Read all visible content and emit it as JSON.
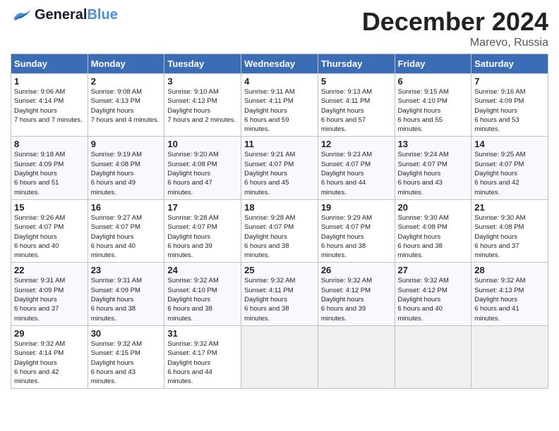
{
  "header": {
    "logo_text_general": "General",
    "logo_text_blue": "Blue",
    "month_title": "December 2024",
    "location": "Marevo, Russia"
  },
  "calendar": {
    "days_of_week": [
      "Sunday",
      "Monday",
      "Tuesday",
      "Wednesday",
      "Thursday",
      "Friday",
      "Saturday"
    ],
    "weeks": [
      [
        {
          "day": "1",
          "sunrise": "9:06 AM",
          "sunset": "4:14 PM",
          "daylight": "7 hours and 7 minutes."
        },
        {
          "day": "2",
          "sunrise": "9:08 AM",
          "sunset": "4:13 PM",
          "daylight": "7 hours and 4 minutes."
        },
        {
          "day": "3",
          "sunrise": "9:10 AM",
          "sunset": "4:12 PM",
          "daylight": "7 hours and 2 minutes."
        },
        {
          "day": "4",
          "sunrise": "9:11 AM",
          "sunset": "4:11 PM",
          "daylight": "6 hours and 59 minutes."
        },
        {
          "day": "5",
          "sunrise": "9:13 AM",
          "sunset": "4:11 PM",
          "daylight": "6 hours and 57 minutes."
        },
        {
          "day": "6",
          "sunrise": "9:15 AM",
          "sunset": "4:10 PM",
          "daylight": "6 hours and 55 minutes."
        },
        {
          "day": "7",
          "sunrise": "9:16 AM",
          "sunset": "4:09 PM",
          "daylight": "6 hours and 53 minutes."
        }
      ],
      [
        {
          "day": "8",
          "sunrise": "9:18 AM",
          "sunset": "4:09 PM",
          "daylight": "6 hours and 51 minutes."
        },
        {
          "day": "9",
          "sunrise": "9:19 AM",
          "sunset": "4:08 PM",
          "daylight": "6 hours and 49 minutes."
        },
        {
          "day": "10",
          "sunrise": "9:20 AM",
          "sunset": "4:08 PM",
          "daylight": "6 hours and 47 minutes."
        },
        {
          "day": "11",
          "sunrise": "9:21 AM",
          "sunset": "4:07 PM",
          "daylight": "6 hours and 45 minutes."
        },
        {
          "day": "12",
          "sunrise": "9:23 AM",
          "sunset": "4:07 PM",
          "daylight": "6 hours and 44 minutes."
        },
        {
          "day": "13",
          "sunrise": "9:24 AM",
          "sunset": "4:07 PM",
          "daylight": "6 hours and 43 minutes."
        },
        {
          "day": "14",
          "sunrise": "9:25 AM",
          "sunset": "4:07 PM",
          "daylight": "6 hours and 42 minutes."
        }
      ],
      [
        {
          "day": "15",
          "sunrise": "9:26 AM",
          "sunset": "4:07 PM",
          "daylight": "6 hours and 40 minutes."
        },
        {
          "day": "16",
          "sunrise": "9:27 AM",
          "sunset": "4:07 PM",
          "daylight": "6 hours and 40 minutes."
        },
        {
          "day": "17",
          "sunrise": "9:28 AM",
          "sunset": "4:07 PM",
          "daylight": "6 hours and 39 minutes."
        },
        {
          "day": "18",
          "sunrise": "9:28 AM",
          "sunset": "4:07 PM",
          "daylight": "6 hours and 38 minutes."
        },
        {
          "day": "19",
          "sunrise": "9:29 AM",
          "sunset": "4:07 PM",
          "daylight": "6 hours and 38 minutes."
        },
        {
          "day": "20",
          "sunrise": "9:30 AM",
          "sunset": "4:08 PM",
          "daylight": "6 hours and 38 minutes."
        },
        {
          "day": "21",
          "sunrise": "9:30 AM",
          "sunset": "4:08 PM",
          "daylight": "6 hours and 37 minutes."
        }
      ],
      [
        {
          "day": "22",
          "sunrise": "9:31 AM",
          "sunset": "4:09 PM",
          "daylight": "6 hours and 37 minutes."
        },
        {
          "day": "23",
          "sunrise": "9:31 AM",
          "sunset": "4:09 PM",
          "daylight": "6 hours and 38 minutes."
        },
        {
          "day": "24",
          "sunrise": "9:32 AM",
          "sunset": "4:10 PM",
          "daylight": "6 hours and 38 minutes."
        },
        {
          "day": "25",
          "sunrise": "9:32 AM",
          "sunset": "4:11 PM",
          "daylight": "6 hours and 38 minutes."
        },
        {
          "day": "26",
          "sunrise": "9:32 AM",
          "sunset": "4:12 PM",
          "daylight": "6 hours and 39 minutes."
        },
        {
          "day": "27",
          "sunrise": "9:32 AM",
          "sunset": "4:12 PM",
          "daylight": "6 hours and 40 minutes."
        },
        {
          "day": "28",
          "sunrise": "9:32 AM",
          "sunset": "4:13 PM",
          "daylight": "6 hours and 41 minutes."
        }
      ],
      [
        {
          "day": "29",
          "sunrise": "9:32 AM",
          "sunset": "4:14 PM",
          "daylight": "6 hours and 42 minutes."
        },
        {
          "day": "30",
          "sunrise": "9:32 AM",
          "sunset": "4:15 PM",
          "daylight": "6 hours and 43 minutes."
        },
        {
          "day": "31",
          "sunrise": "9:32 AM",
          "sunset": "4:17 PM",
          "daylight": "6 hours and 44 minutes."
        },
        null,
        null,
        null,
        null
      ]
    ]
  }
}
